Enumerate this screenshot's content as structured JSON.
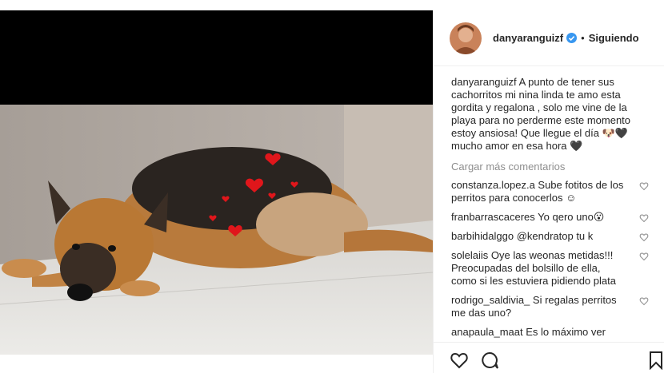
{
  "post": {
    "username": "danyaranguizf",
    "follow_status": "Siguiendo",
    "separator": "•",
    "caption_user": "danyaranguizf",
    "caption_text": " A punto de tener sus cachorritos mi nina linda te amo esta gordita y regalona , solo me vine de la playa para no perderme este momento estoy ansiosa! Que llegue el día 🐶🖤mucho amor en esa hora 🖤",
    "load_more": "Cargar más comentarios"
  },
  "comments": [
    {
      "user": "constanza.lopez.a",
      "text": " Sube fotitos de los perritos para conocerlos ☺"
    },
    {
      "user": "franbarrascaceres",
      "text": " Yo qero uno😮"
    },
    {
      "user": "barbihidalggo",
      "text": " @kendratop tu k"
    },
    {
      "user": "solelaiis",
      "text": " Oye las weonas metidas!!! Preocupadas del bolsillo de ella, como si les estuviera pidiendo plata"
    },
    {
      "user": "rodrigo_saldivia_",
      "text": " Si regalas perritos me das uno?"
    },
    {
      "user": "anapaula_maat",
      "text": " Es lo máximo ver nacer"
    }
  ],
  "icons": {
    "verified": "verified-badge-icon",
    "like": "heart-icon",
    "comment": "comment-bubble-icon",
    "save": "bookmark-icon"
  },
  "colors": {
    "verified": "#3897f0",
    "text": "#262626",
    "muted": "#8e8e8e",
    "border": "#efefef"
  }
}
